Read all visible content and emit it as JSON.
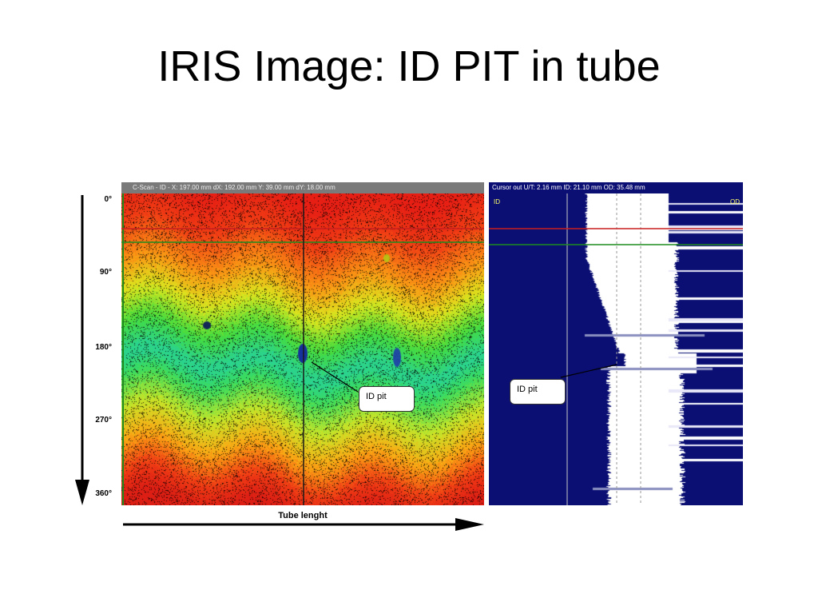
{
  "slide": {
    "title": "IRIS Image: ID PIT in tube"
  },
  "rotation_axis": {
    "labels": [
      "0°",
      "90°",
      "180°",
      "270°",
      "360°"
    ]
  },
  "cscan": {
    "header": "C-Scan - ID - X: 197.00 mm   dX: 192.00 mm   Y: 39.00 mm   dY: 18.00 mm",
    "callout": "ID pit"
  },
  "bscan": {
    "header": "Cursor out  U/T: 2.16 mm  ID: 21.10 mm  OD: 35.48 mm",
    "id_tag": "ID",
    "od_tag": "OD",
    "callout": "ID pit"
  },
  "tube_axis": {
    "label": "Tube lenght"
  },
  "colors": {
    "bscan_background": "#0b0f73",
    "cursor_red": "#c81e1e",
    "cursor_green": "#1e8c1e"
  }
}
